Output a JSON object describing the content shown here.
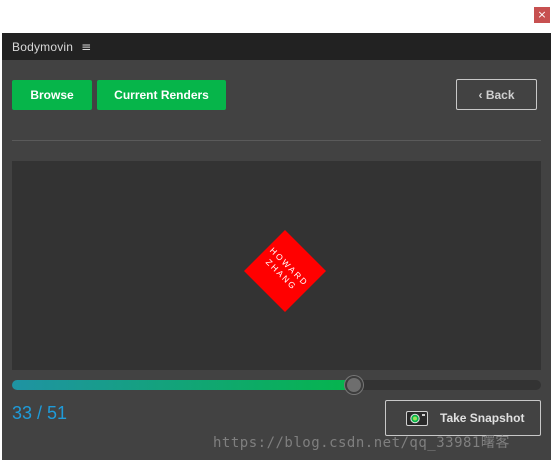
{
  "window": {
    "close_glyph": "×",
    "close_color": "#c75050"
  },
  "panel": {
    "title": "Bodymovin",
    "menu_glyph": "≡"
  },
  "toolbar": {
    "browse_label": "Browse",
    "current_renders_label": "Current Renders",
    "back_label": "‹ Back",
    "accent": "#06b54a"
  },
  "preview": {
    "shape_color": "#ff0000",
    "shape_text_line1": "HOWARD",
    "shape_text_line2": "ZHANG"
  },
  "timeline": {
    "current_frame": 33,
    "total_frames": 51,
    "frame_text": "33 / 51",
    "progress_fraction": 0.647
  },
  "snapshot": {
    "label": "Take Snapshot",
    "icon": "camera-icon"
  },
  "watermark": {
    "text": "https://blog.csdn.net/qq_33981曙客"
  }
}
